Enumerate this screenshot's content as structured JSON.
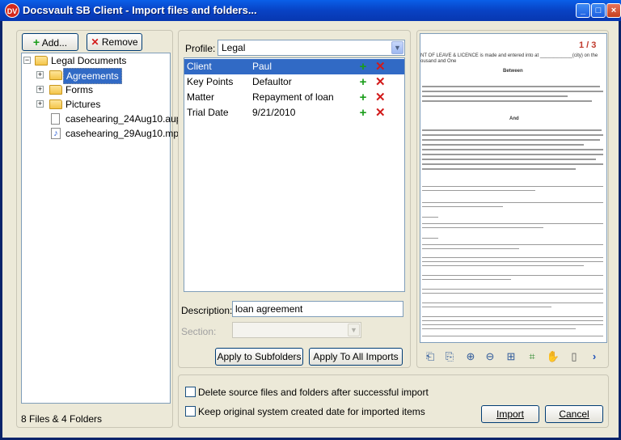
{
  "window": {
    "title": "Docsvault SB Client - Import files and folders...",
    "app_badge": "DV",
    "minimize": "_",
    "maximize": "□",
    "close": "×"
  },
  "left": {
    "add_label": "Add...",
    "remove_label": "Remove",
    "tree": [
      {
        "label": "Legal Documents"
      },
      {
        "label": "Agreements"
      },
      {
        "label": "Forms"
      },
      {
        "label": "Pictures"
      },
      {
        "label": "casehearing_24Aug10.aup"
      },
      {
        "label": "casehearing_29Aug10.mp3"
      }
    ],
    "status": "8 Files & 4 Folders"
  },
  "middle": {
    "profile_label": "Profile:",
    "profile_value": "Legal",
    "properties": [
      {
        "name": "Client",
        "value": "Paul"
      },
      {
        "name": "Key Points",
        "value": "Defaultor"
      },
      {
        "name": "Matter",
        "value": "Repayment of loan"
      },
      {
        "name": "Trial Date",
        "value": "9/21/2010"
      }
    ],
    "description_label": "Description:",
    "description_value": "loan agreement",
    "section_label": "Section:",
    "apply_subfolders": "Apply to Subfolders",
    "apply_all": "Apply To All Imports"
  },
  "preview": {
    "page_indicator": "1 / 3",
    "heading_between": "Between",
    "heading_and": "And",
    "line1": "NT OF LEAVE & LICENCE is made and entered into at ____________(city) on the",
    "line2": "ousand and One",
    "tools": [
      "page-prev-icon",
      "page-next-icon",
      "zoom-in-icon",
      "zoom-out-icon",
      "zoom-fit-icon",
      "fit-page-icon",
      "pan-hand-icon",
      "mouse-icon",
      "more-icon"
    ]
  },
  "bottom": {
    "delete_label": "Delete source files and folders after successful import",
    "keep_label": "Keep original system created date for imported items",
    "import_label": "Import",
    "cancel_label": "Cancel"
  }
}
